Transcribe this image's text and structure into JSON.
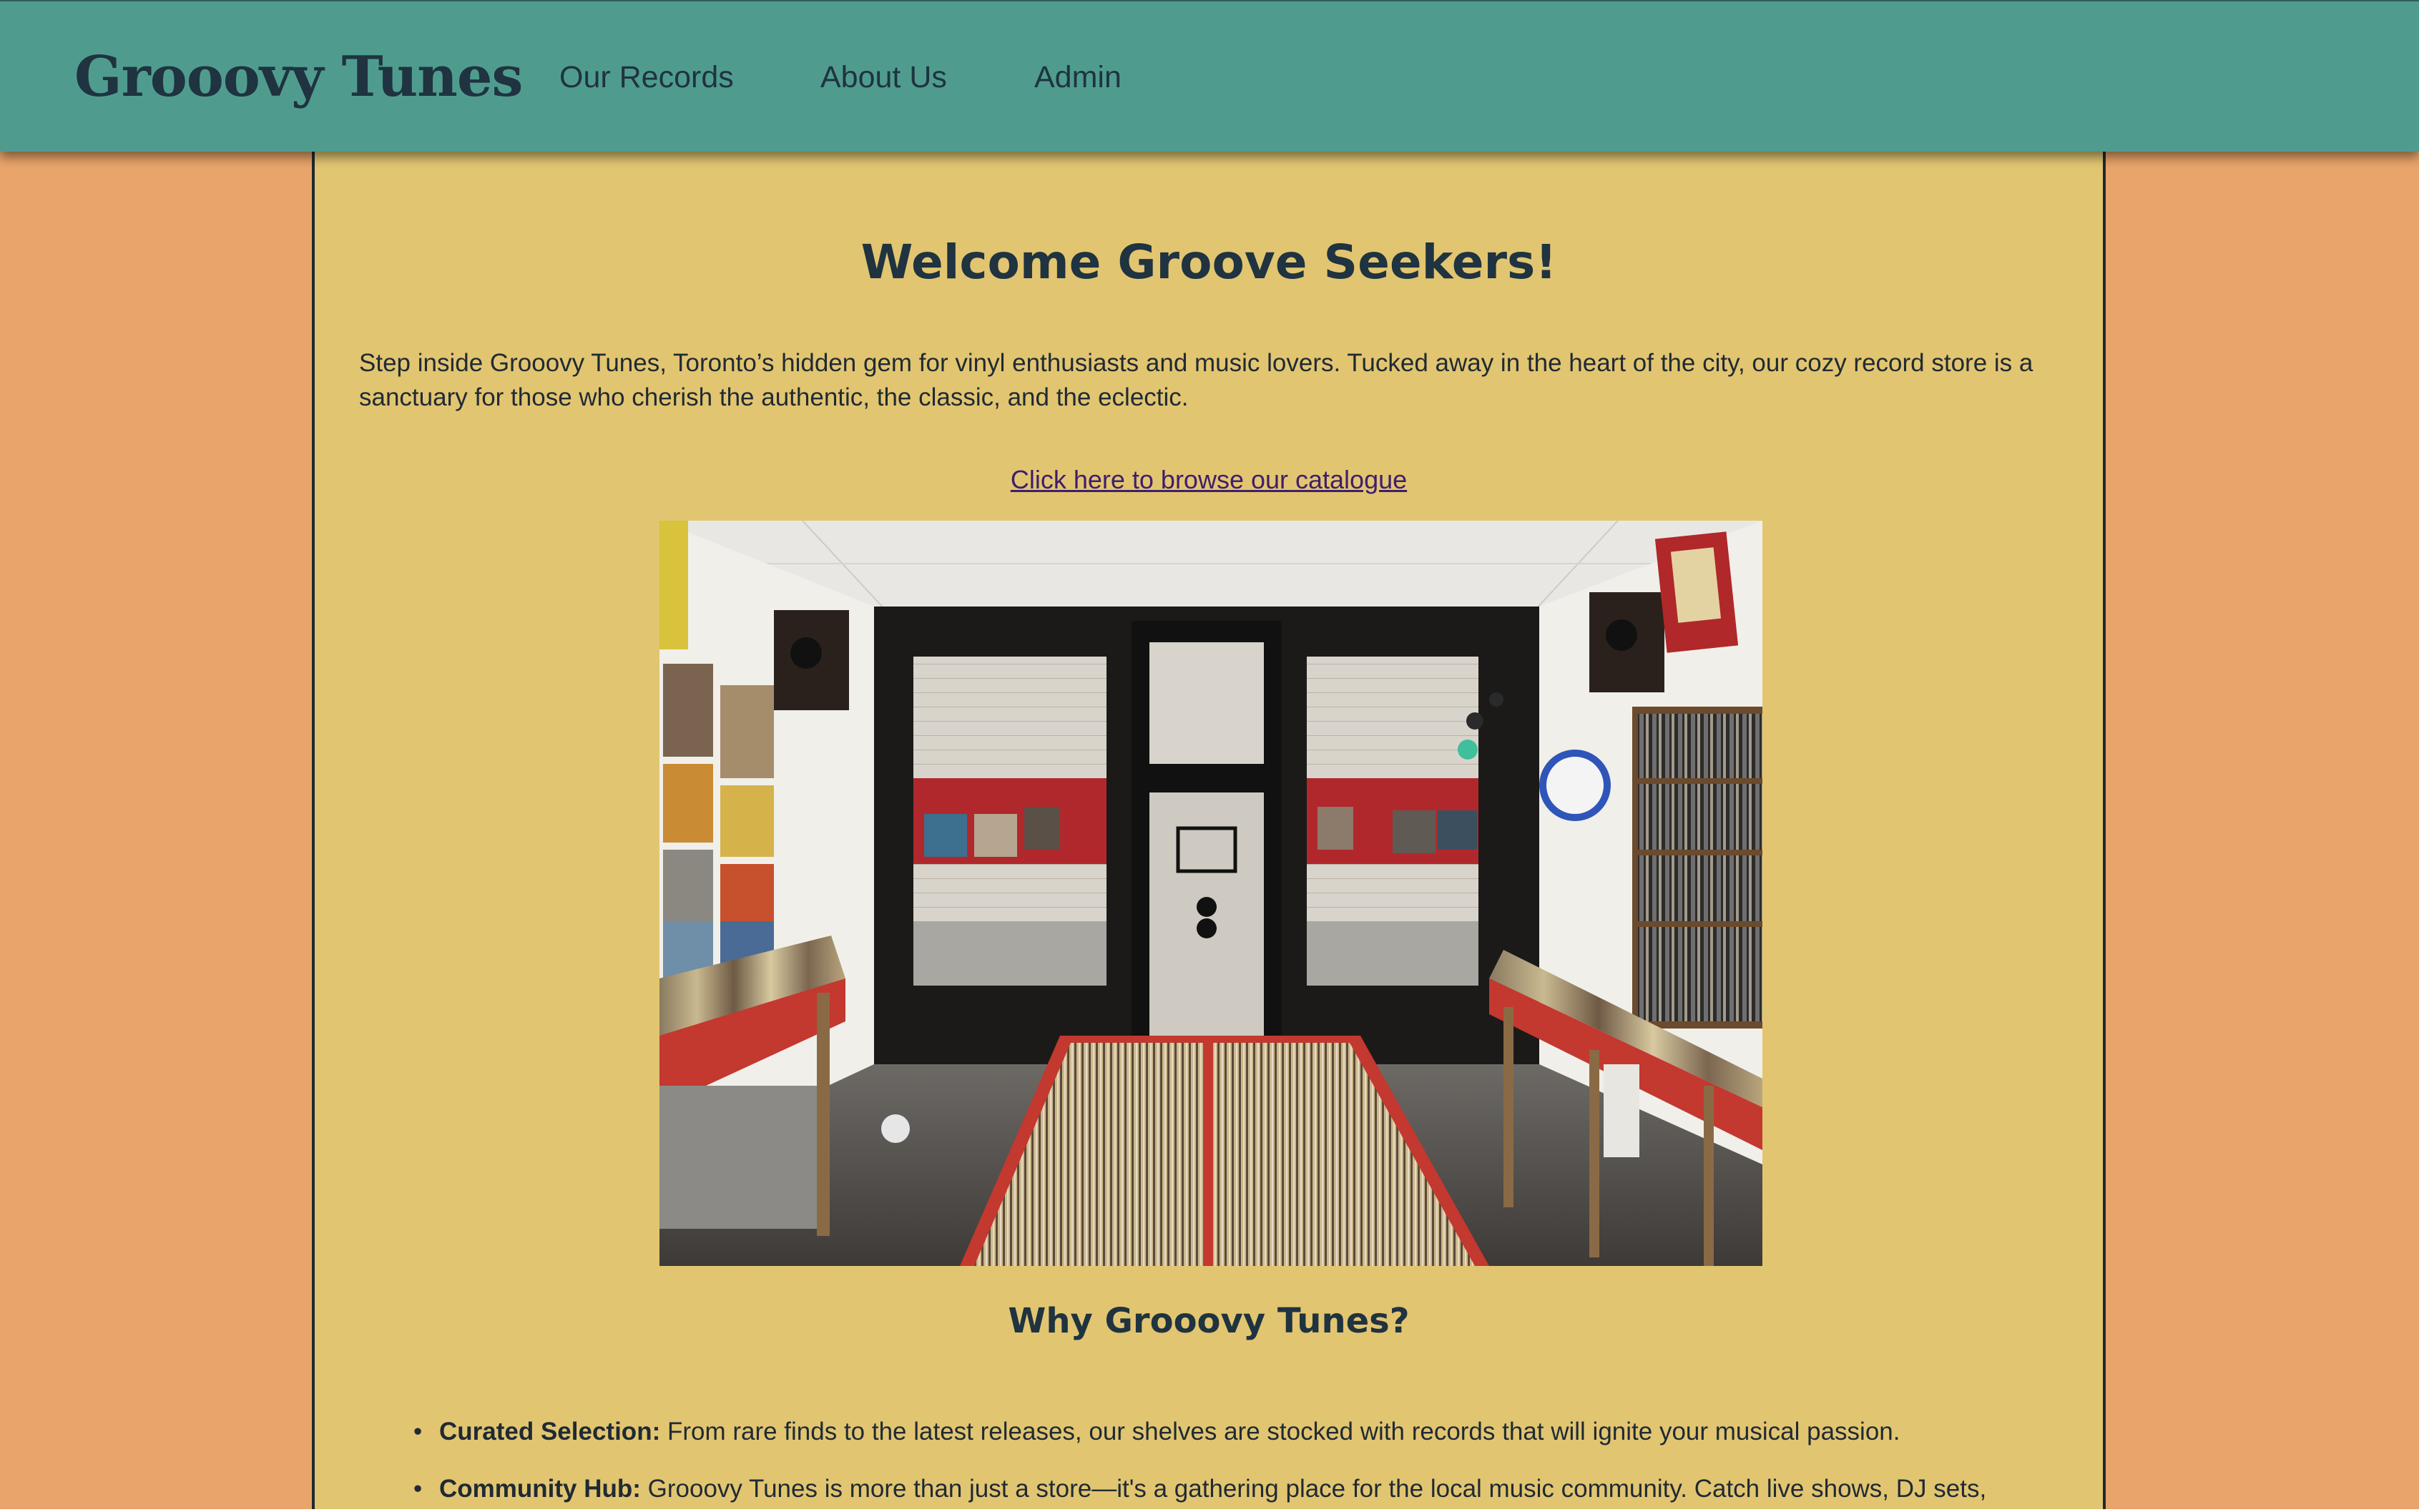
{
  "header": {
    "brand": "Grooovy Tunes",
    "nav": [
      {
        "label": "Our Records"
      },
      {
        "label": "About Us"
      },
      {
        "label": "Admin"
      }
    ]
  },
  "main": {
    "title": "Welcome Groove Seekers!",
    "intro": "Step inside Grooovy Tunes, Toronto’s hidden gem for vinyl enthusiasts and music lovers. Tucked away in the heart of the city, our cozy record store is a sanctuary for those who cherish the authentic, the classic, and the eclectic.",
    "catalogue_link": "Click here to browse our catalogue",
    "photo_alt": "Record store interior",
    "why_heading": "Why Grooovy Tunes?",
    "features": [
      {
        "title": "Curated Selection:",
        "text": " From rare finds to the latest releases, our shelves are stocked with records that will ignite your musical passion."
      },
      {
        "title": "Community Hub:",
        "text": " Grooovy Tunes is more than just a store—it's a gathering place for the local music community. Catch live shows, DJ sets,"
      }
    ]
  },
  "colors": {
    "page_background": "#E8A46A",
    "header": "#4F9C8F",
    "content_panel": "#E2C571",
    "heading_text": "#1F3340",
    "link": "#3F1E6B"
  }
}
